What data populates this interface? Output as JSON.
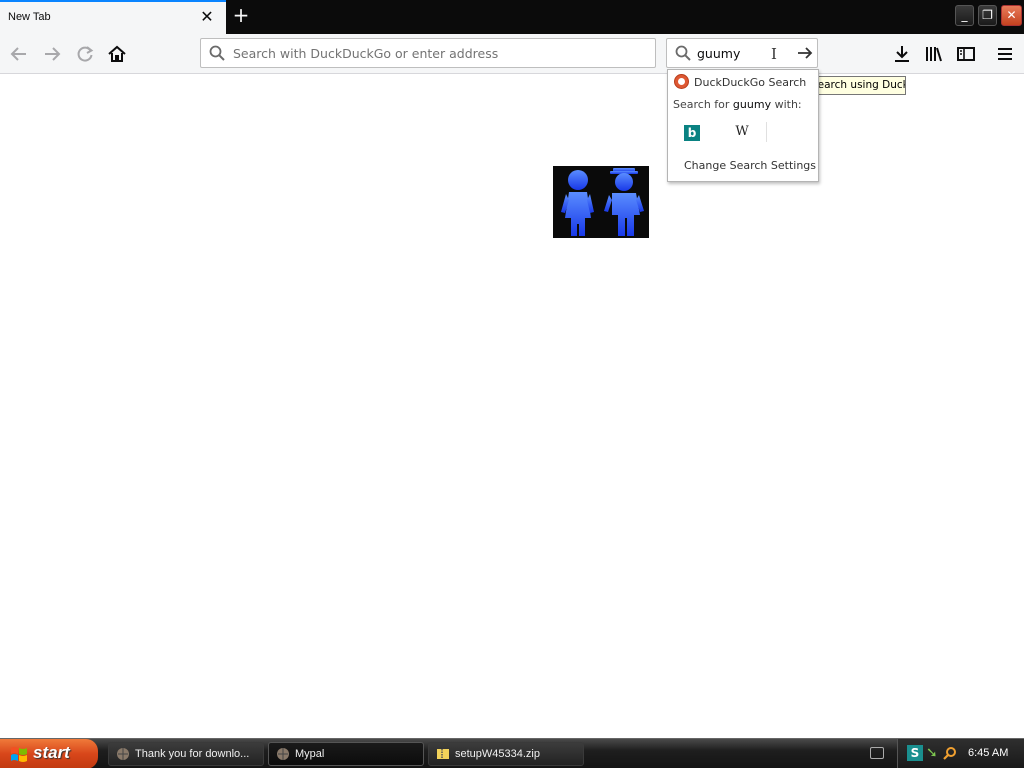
{
  "tab": {
    "title": "New Tab"
  },
  "toolbar": {
    "url_placeholder": "Search with DuckDuckGo or enter address",
    "search_value": "guumy"
  },
  "search_popup": {
    "engine": "DuckDuckGo Search",
    "search_for_prefix": "Search for ",
    "search_for_term": "guumy",
    "search_for_suffix": " with:",
    "alt_engines": [
      "Bing",
      "Wikipedia"
    ],
    "wiki_glyph": "W",
    "bing_glyph": "b",
    "settings_label": "Change Search Settings"
  },
  "tooltip": {
    "text": "Search using DuckDuckGo"
  },
  "taskbar": {
    "start_label": "start",
    "tasks": [
      {
        "label": "Thank you for downlo..."
      },
      {
        "label": "Mypal"
      },
      {
        "label": "setupW45334.zip"
      }
    ],
    "tray_s": "S",
    "clock": "6:45 AM"
  },
  "colors": {
    "accent": "#0a84ff",
    "toolbar_bg": "#f5f6f7",
    "tabbar_bg": "#0b0b0b",
    "people_blue": "#1f5cff"
  },
  "icons": [
    "close-icon",
    "plus-icon",
    "back-arrow-icon",
    "forward-arrow-icon",
    "reload-icon",
    "home-icon",
    "search-icon",
    "arrow-right-icon",
    "download-icon",
    "library-icon",
    "sidebar-icon",
    "hamburger-menu-icon",
    "duckduckgo-icon",
    "bing-icon",
    "wikipedia-icon",
    "windows-logo-icon"
  ]
}
